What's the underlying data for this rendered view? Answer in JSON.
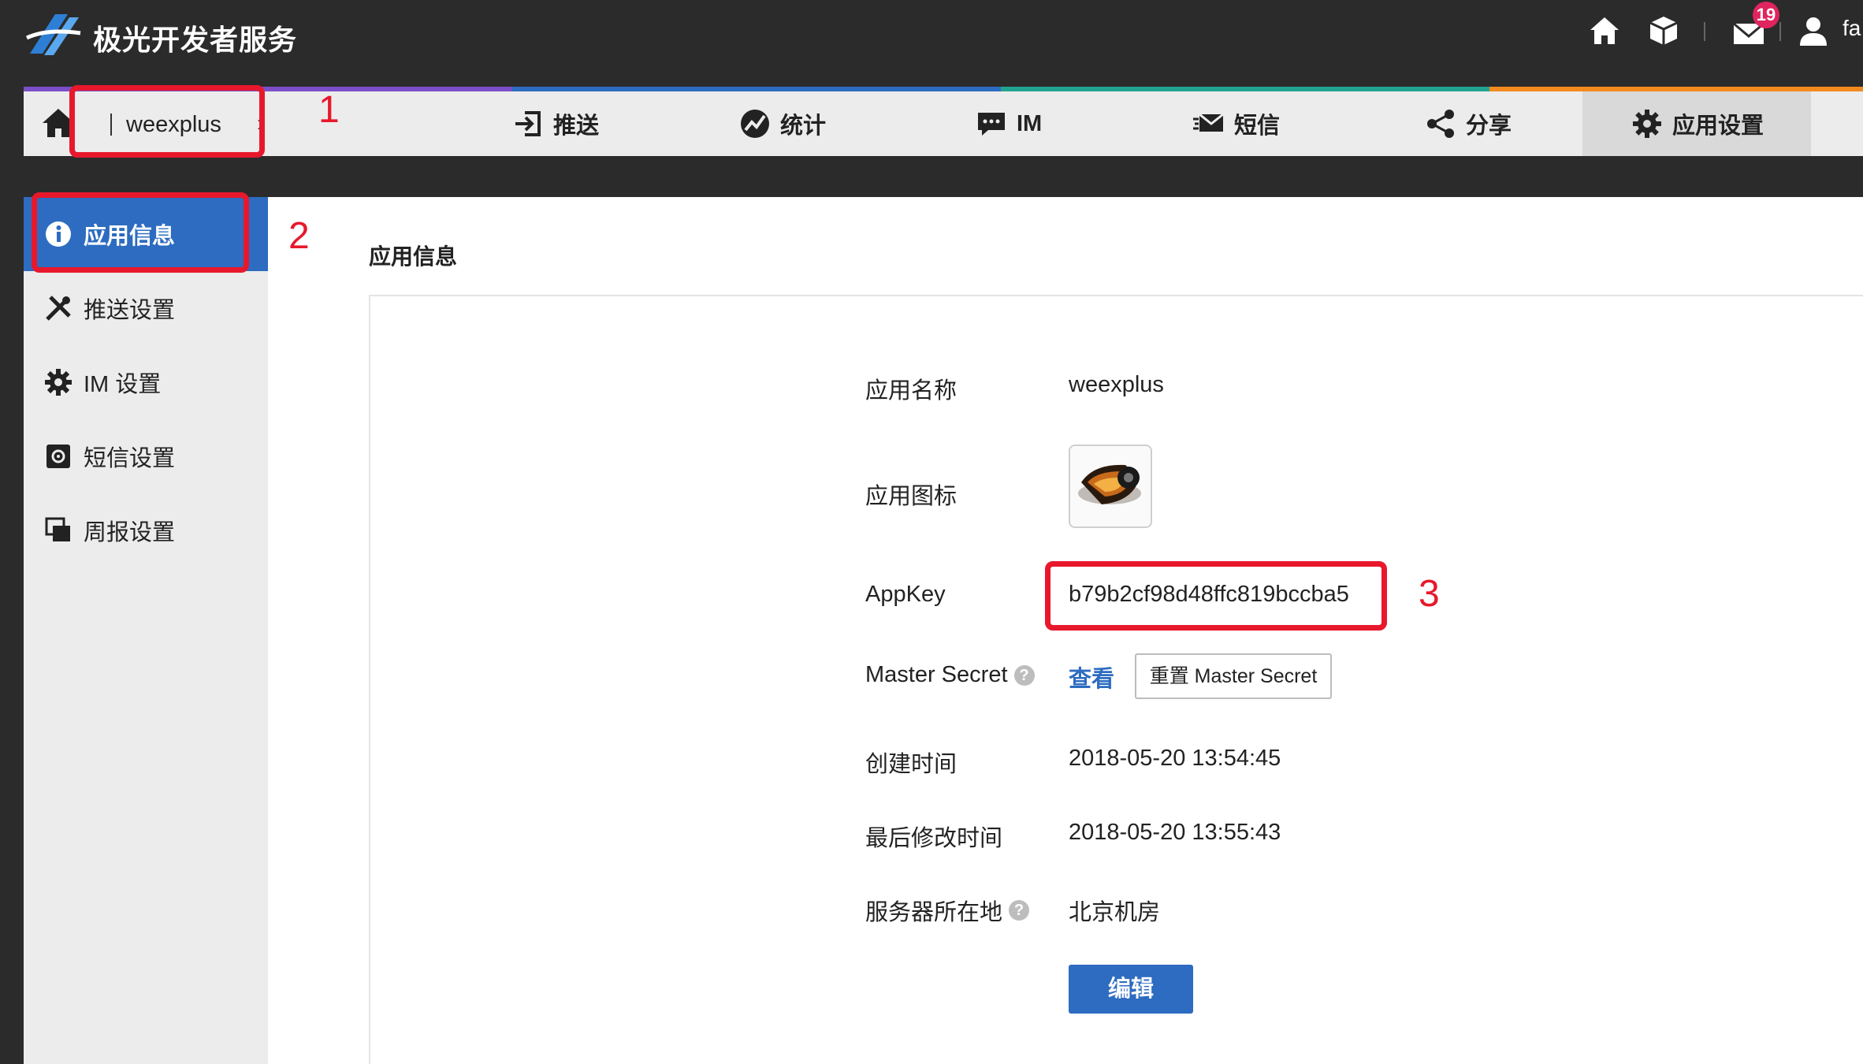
{
  "header": {
    "brand": "极光开发者服务",
    "unread_count": "19",
    "user_name": "fa",
    "icons": [
      "home-icon",
      "cube-icon",
      "mail-icon",
      "user-icon"
    ]
  },
  "nav": {
    "app_name": "weexplus",
    "chevron": "›",
    "items": [
      {
        "label": "推送",
        "icon": "push-icon"
      },
      {
        "label": "统计",
        "icon": "stats-icon"
      },
      {
        "label": "IM",
        "icon": "chat-icon"
      },
      {
        "label": "短信",
        "icon": "sms-icon"
      },
      {
        "label": "分享",
        "icon": "share-icon"
      },
      {
        "label": "应用设置",
        "icon": "gear-icon"
      }
    ],
    "active": "应用设置",
    "strip_colors": [
      "#7b4fc9",
      "#2d6cc0",
      "#22a38f",
      "#f28a1e"
    ]
  },
  "sidebar": {
    "items": [
      {
        "label": "应用信息",
        "icon": "info-icon",
        "active": true
      },
      {
        "label": "推送设置",
        "icon": "tools-icon"
      },
      {
        "label": "IM 设置",
        "icon": "cog-icon"
      },
      {
        "label": "短信设置",
        "icon": "sms-settings-icon"
      },
      {
        "label": "周报设置",
        "icon": "report-icon"
      }
    ]
  },
  "main": {
    "title": "应用信息",
    "labels": {
      "app_name": "应用名称",
      "app_icon": "应用图标",
      "appkey": "AppKey",
      "master_secret": "Master Secret",
      "created": "创建时间",
      "modified": "最后修改时间",
      "server": "服务器所在地"
    },
    "values": {
      "app_name": "weexplus",
      "appkey": "b79b2cf98d48ffc819bccba5",
      "created": "2018-05-20 13:54:45",
      "modified": "2018-05-20 13:55:43",
      "server": "北京机房"
    },
    "help_mark": "?",
    "view_link": "查看",
    "reset_button": "重置 Master Secret",
    "edit_button": "编辑"
  },
  "annotations": [
    "1",
    "2",
    "3"
  ],
  "colors": {
    "accent": "#2d6cc0",
    "annotation": "#e8182c",
    "badge": "#e0245e"
  }
}
